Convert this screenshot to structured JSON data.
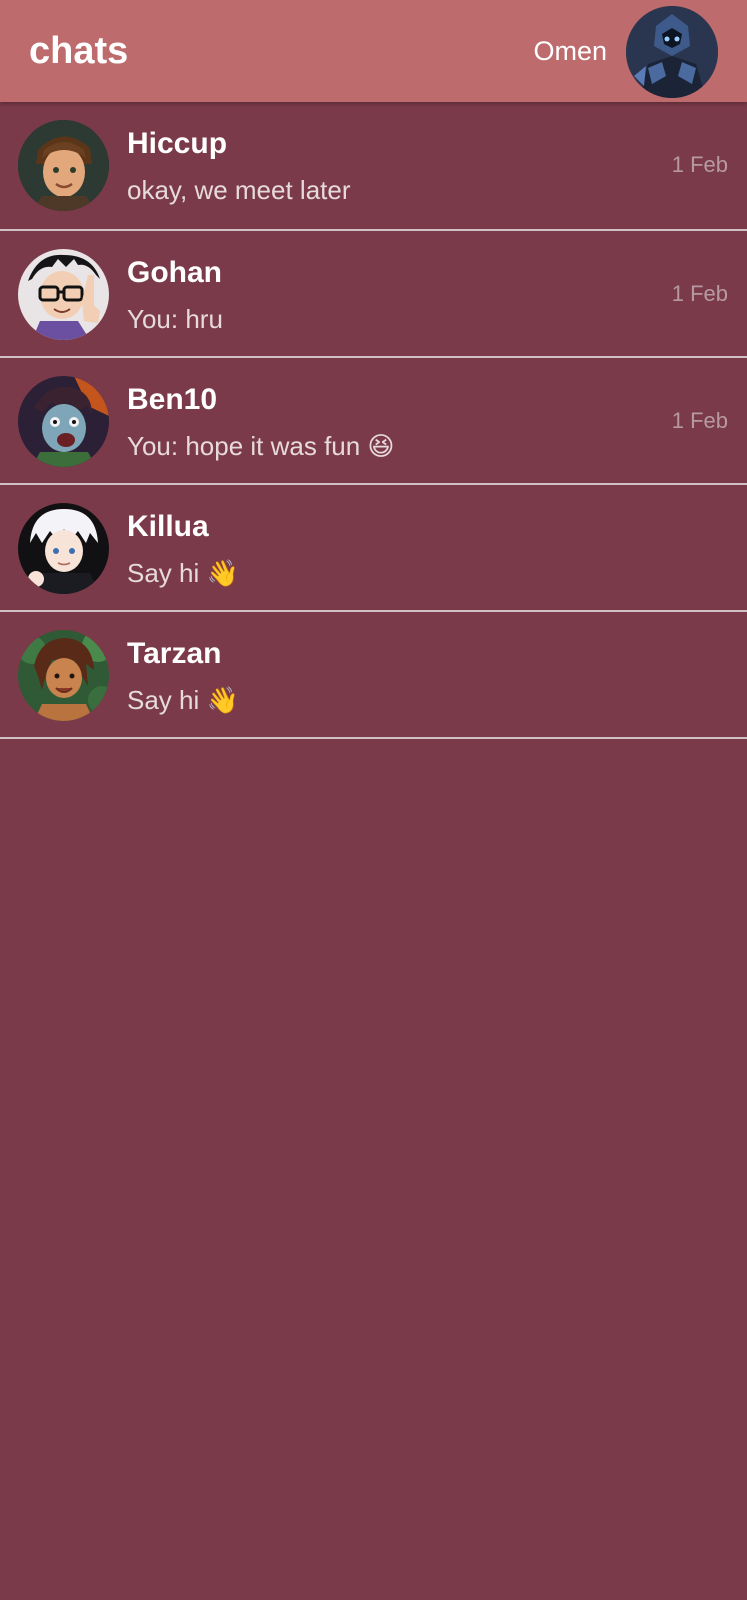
{
  "header": {
    "title": "chats",
    "user_name": "Omen",
    "user_avatar": "omen-avatar"
  },
  "colors": {
    "header_bg": "#bd6b6c",
    "list_bg": "#7b3a4a",
    "divider": "#cfc1c5",
    "name_text": "#ffffff",
    "preview_text": "#e6dadd",
    "time_text": "#b59aa2"
  },
  "chats": [
    {
      "name": "Hiccup",
      "preview": "okay, we meet later",
      "time": "1 Feb",
      "avatar": "hiccup-avatar"
    },
    {
      "name": "Gohan",
      "preview": "You: hru",
      "time": "1 Feb",
      "avatar": "gohan-avatar"
    },
    {
      "name": "Ben10",
      "preview": "You: hope it was fun 😆",
      "time": "1 Feb",
      "avatar": "ben10-avatar"
    },
    {
      "name": "Killua",
      "preview": "Say hi 👋",
      "time": "",
      "avatar": "killua-avatar"
    },
    {
      "name": "Tarzan",
      "preview": "Say hi 👋",
      "time": "",
      "avatar": "tarzan-avatar"
    }
  ]
}
